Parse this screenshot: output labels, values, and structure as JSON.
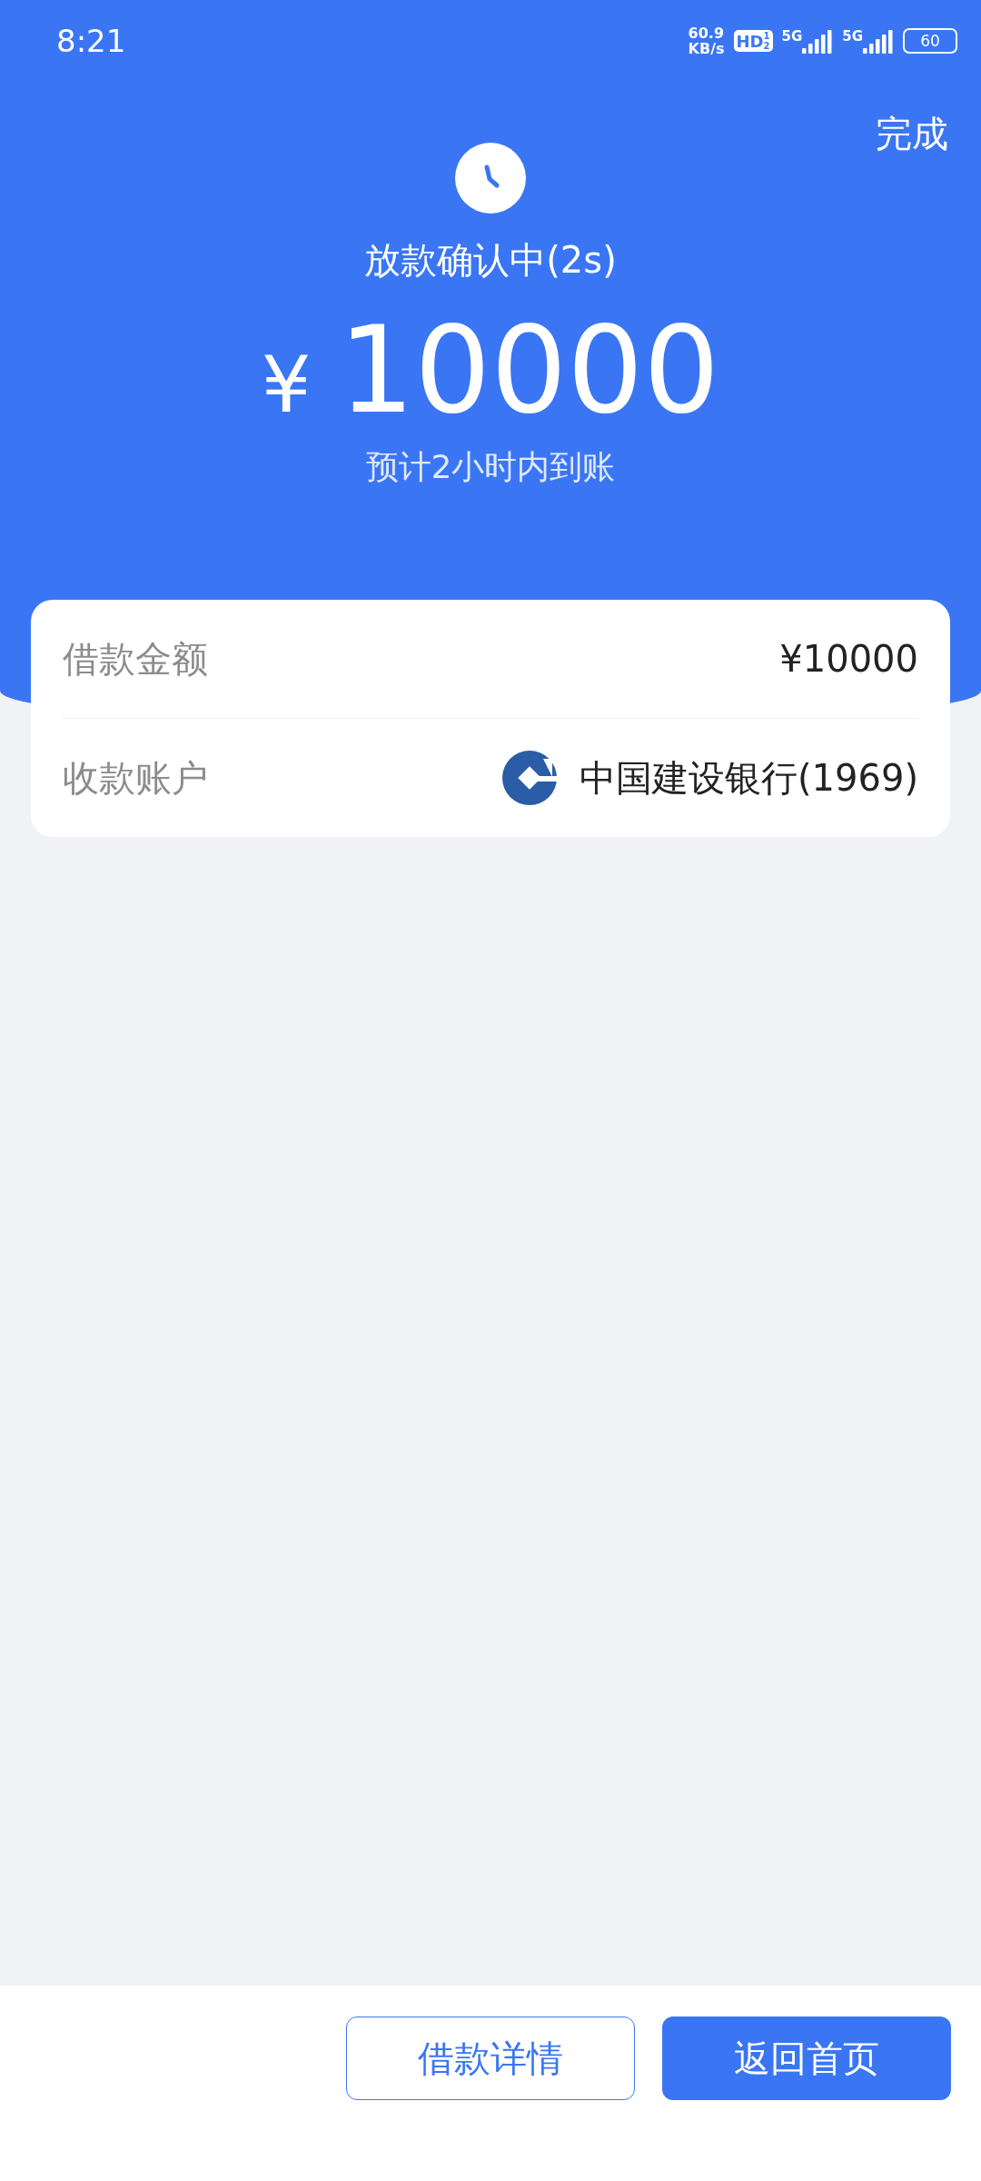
{
  "status_bar": {
    "time": "8:21",
    "net_speed": [
      "60.9",
      "KB/s"
    ],
    "hd": "HD",
    "hd_slots": [
      "1",
      "2"
    ],
    "sims": [
      {
        "label": "5G"
      },
      {
        "label": "5G"
      }
    ],
    "battery": "60"
  },
  "header": {
    "done": "完成",
    "status": "放款确认中(2s)",
    "currency": "¥",
    "amount": "10000",
    "eta": "预计2小时内到账"
  },
  "details": [
    {
      "label": "借款金额",
      "value": "¥10000",
      "kind": "text"
    },
    {
      "label": "收款账户",
      "value": "中国建设银行(1969)",
      "kind": "bank"
    }
  ],
  "buttons": [
    {
      "label": "借款详情",
      "kind": "outline"
    },
    {
      "label": "返回首页",
      "kind": "primary"
    }
  ]
}
